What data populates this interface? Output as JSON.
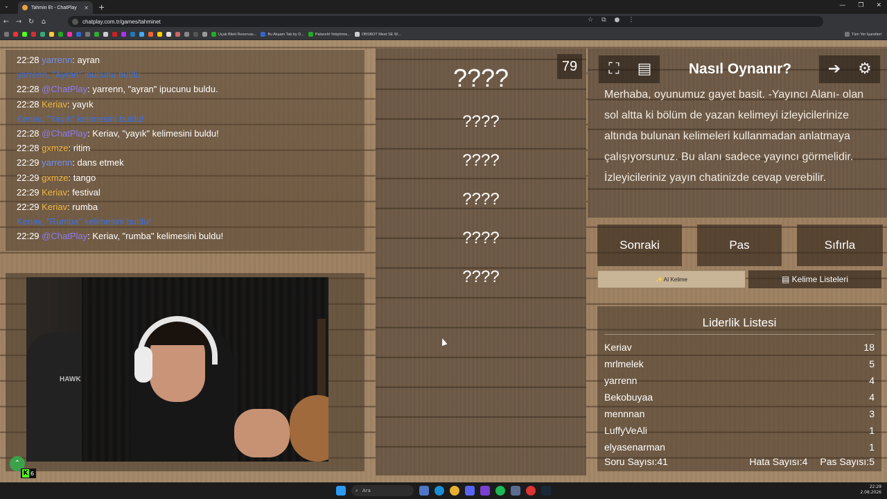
{
  "browser": {
    "tab_title": "Tahmin Et - ChatPlay",
    "url": "chatplay.com.tr/games/tahminet",
    "bookmarks": [
      "Uçak Bileti Rezervas...",
      "Bu Akşam Tab by D...",
      "Palworld Yetiştirme...",
      "OBSBOT Meet SE W..."
    ],
    "all_bookmarks": "Tüm Yer İşaretleri"
  },
  "chat": {
    "lines": [
      {
        "time": "22:28",
        "user": "yarrenn",
        "user_color": "#6f8ff0",
        "text": ": ayran",
        "type": "msg"
      },
      {
        "type": "sys",
        "text": "yarrenn, \"Ayran\" ipucunu buldu.",
        "color": "#3b6fe0"
      },
      {
        "time": "22:28",
        "user": "@ChatPlay",
        "user_color": "#8c7cf0",
        "text": ": yarrenn, \"ayran\" ipucunu buldu.",
        "type": "msg"
      },
      {
        "time": "22:28",
        "user": "Keriav",
        "user_color": "#f2b53a",
        "text": ": yayık",
        "type": "msg"
      },
      {
        "type": "sys",
        "text": "Keriav, \"Yayık\" kelimesini buldu!",
        "color": "#3b6fe0"
      },
      {
        "time": "22:28",
        "user": "@ChatPlay",
        "user_color": "#8c7cf0",
        "text": ": Keriav, \"yayık\" kelimesini buldu!",
        "type": "msg"
      },
      {
        "time": "22:28",
        "user": "gxmze",
        "user_color": "#f2b53a",
        "text": ": ritim",
        "type": "msg"
      },
      {
        "time": "22:29",
        "user": "yarrenn",
        "user_color": "#6f8ff0",
        "text": ": dans etmek",
        "type": "msg"
      },
      {
        "time": "22:29",
        "user": "gxmze",
        "user_color": "#f2b53a",
        "text": ": tango",
        "type": "msg"
      },
      {
        "time": "22:29",
        "user": "Keriav",
        "user_color": "#f2b53a",
        "text": ": festival",
        "type": "msg"
      },
      {
        "time": "22:29",
        "user": "Keriav",
        "user_color": "#f2b53a",
        "text": ": rumba",
        "type": "msg"
      },
      {
        "type": "sys",
        "text": "Keriav, \"Rumba\" kelimesini buldu!",
        "color": "#3b6fe0"
      },
      {
        "time": "22:29",
        "user": "@ChatPlay",
        "user_color": "#8c7cf0",
        "text": ": Keriav, \"rumba\" kelimesini buldu!",
        "type": "msg"
      }
    ]
  },
  "camera": {
    "chair_brand": "HAWK",
    "kick_count": "6"
  },
  "game": {
    "counter": "79",
    "words": [
      "????",
      "????",
      "????",
      "????",
      "????",
      "????"
    ]
  },
  "howto": {
    "title": "Nasıl Oynanır?",
    "text": "Merhaba, oyunumuz gayet basit. -Yayıncı Alanı- olan sol altta ki bölüm de yazan kelimeyi izleyicilerinize altında bulunan kelimeleri kullanmadan anlatmaya çalışıyorsunuz. Bu alanı sadece yayıncı görmelidir. İzleyicileriniz yayın chatinizde cevap verebilir."
  },
  "actions": {
    "next": "Sonraki",
    "pass": "Pas",
    "reset": "Sıfırla"
  },
  "tabs": {
    "ai": "AI Kelime",
    "lists": "Kelime Listeleri"
  },
  "leaderboard": {
    "title": "Liderlik Listesi",
    "rows": [
      {
        "name": "Keriav",
        "score": "18"
      },
      {
        "name": "mrlmelek",
        "score": "5"
      },
      {
        "name": "yarrenn",
        "score": "4"
      },
      {
        "name": "Bekobuyaa",
        "score": "4"
      },
      {
        "name": "mennnan",
        "score": "3"
      },
      {
        "name": "LuffyVeAli",
        "score": "1"
      },
      {
        "name": "elyasenarman",
        "score": "1"
      }
    ],
    "questions_label": "Soru Sayısı:",
    "questions": "41",
    "errors_label": "Hata Sayısı:",
    "errors": "4",
    "passes_label": "Pas Sayısı:",
    "passes": "5"
  },
  "taskbar": {
    "search": "Ara",
    "time": "22:29",
    "date": "2.08.2026"
  }
}
